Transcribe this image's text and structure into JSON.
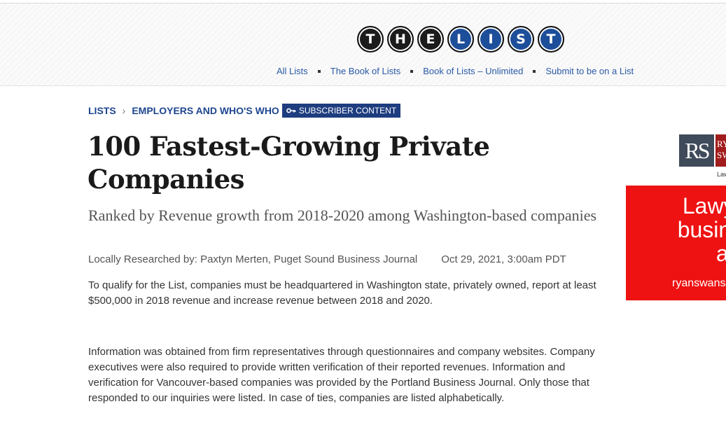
{
  "logo": {
    "letters": [
      "T",
      "H",
      "E",
      "L",
      "I",
      "S",
      "T"
    ]
  },
  "subnav": {
    "items": [
      {
        "label": "All Lists"
      },
      {
        "label": "The Book of Lists"
      },
      {
        "label": "Book of Lists – Unlimited"
      },
      {
        "label": "Submit to be on a List"
      }
    ]
  },
  "breadcrumb": {
    "items": [
      "LISTS",
      "EMPLOYERS AND WHO'S WHO"
    ],
    "badge": "SUBSCRIBER CONTENT"
  },
  "article": {
    "title_line1": "100 Fastest-Growing Private",
    "title_line2": "Companies",
    "subtitle": "Ranked by Revenue growth from 2018-2020 among Washington-based companies",
    "byline": "Locally Researched by: Paxtyn Merten, Puget Sound Business Journal",
    "date": "Oct 29, 2021, 3:00am PDT",
    "para1": "To qualify for the List, companies must be headquartered in Washington state, privately owned, report at least $500,000 in 2018 revenue and increase revenue between 2018 and 2020.",
    "para2": "Information was obtained from firm representatives through questionnaires and company websites. Company executives were also required to provide written verification of their reported revenues. Information and verification for Vancouver-based companies was provided by the Portland Business Journal. Only those that responded to our inquiries were listed. In case of ties, companies are listed alphabetically."
  },
  "ad": {
    "logo_mark": "RS",
    "logo_side": "RY SW",
    "logo_small": "Law",
    "headline_lines": [
      "Lawyers",
      "business",
      "and t"
    ],
    "url": "ryanswans"
  },
  "colors": {
    "link_blue": "#2a5aa6",
    "breadcrumb_blue": "#1e4690",
    "badge_bg": "#1e3d7f",
    "ad_red": "#ee1212"
  }
}
